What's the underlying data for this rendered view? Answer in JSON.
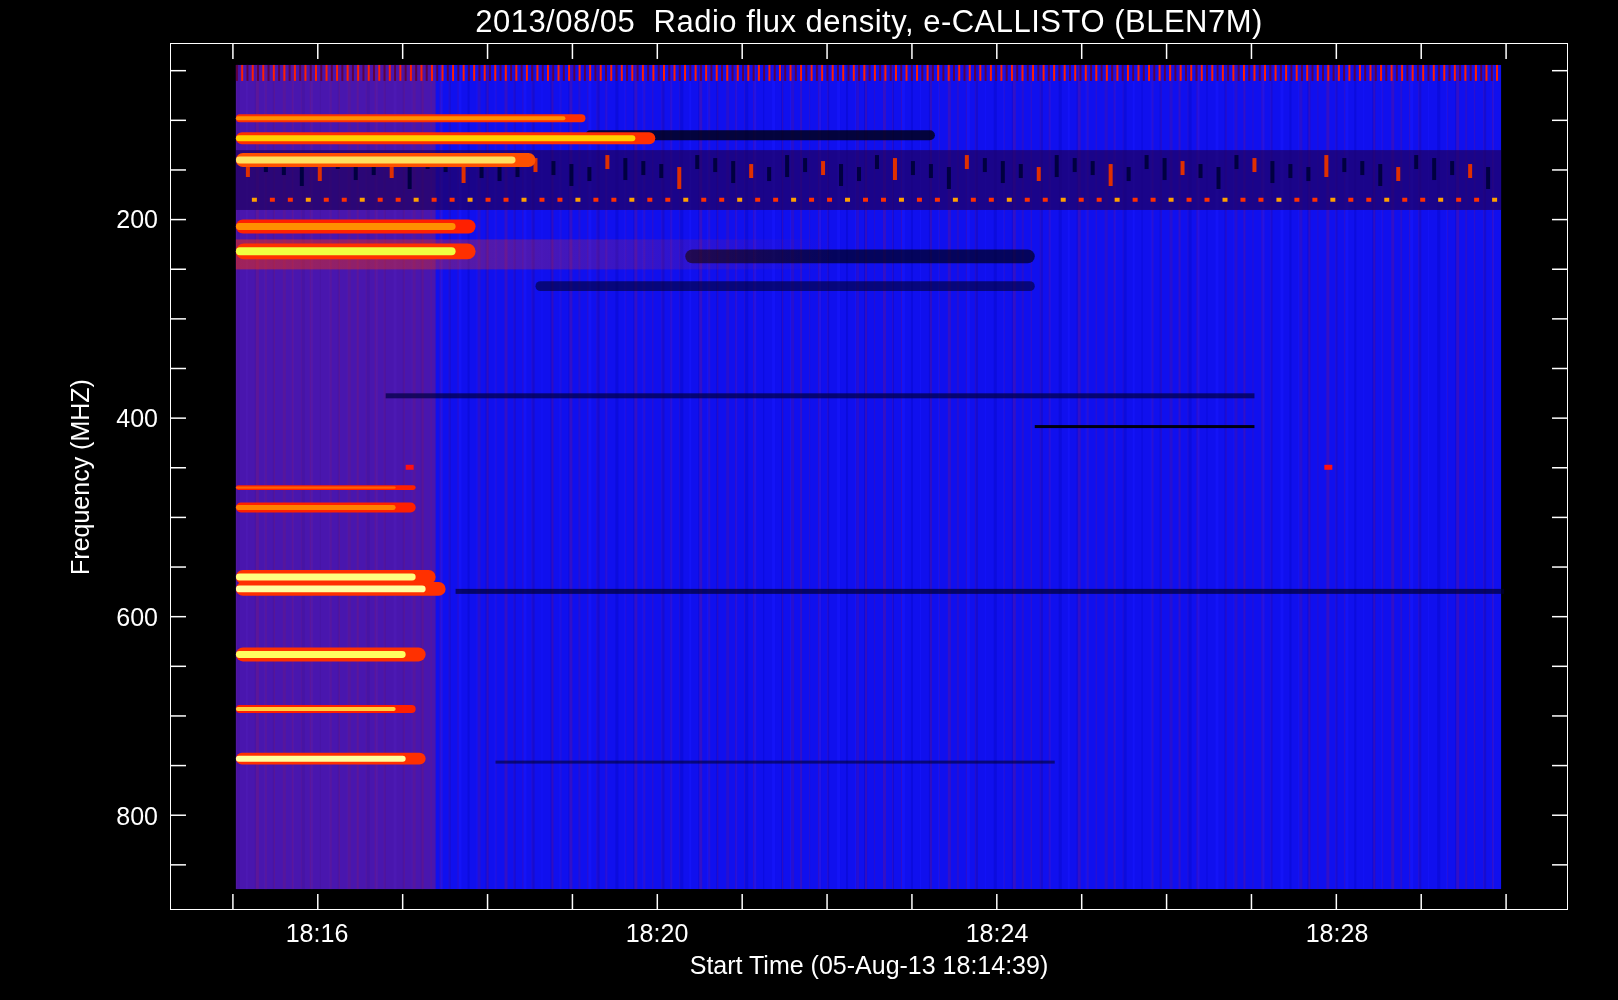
{
  "title": "2013/08/05  Radio flux density, e-CALLISTO (BLEN7M)",
  "y_axis": {
    "label": "Frequency (MHZ)",
    "ticks": [
      "200",
      "400",
      "600",
      "800"
    ]
  },
  "x_axis": {
    "label": "Start Time (05-Aug-13 18:14:39)",
    "ticks": [
      "18:16",
      "18:20",
      "18:24",
      "18:28"
    ]
  }
}
